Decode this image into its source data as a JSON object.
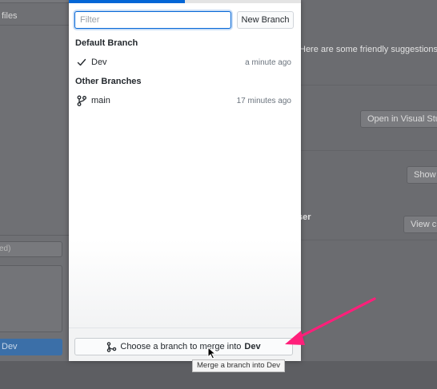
{
  "background": {
    "left_panel": {
      "files_label": "files",
      "summary_fragment": "ed)",
      "commit_fragment": "Dev"
    },
    "right_panel": {
      "suggestions_fragment": "Here are some friendly suggestions",
      "open_editor_fragment": "Open in Visual Stu",
      "show_fragment": "Show",
      "ser_fragment": "ser",
      "view_fragment": "View c"
    }
  },
  "popover": {
    "filter": {
      "placeholder": "Filter",
      "value": ""
    },
    "new_branch_label": "New Branch",
    "default_branch_header": "Default Branch",
    "default_branch": {
      "name": "Dev",
      "time": "a minute ago",
      "icon": "check-icon"
    },
    "other_branches_header": "Other Branches",
    "other_branches": [
      {
        "name": "main",
        "time": "17 minutes ago",
        "icon": "git-branch-icon"
      }
    ],
    "merge_button": {
      "prefix": "Choose a branch to merge into",
      "branch": "Dev",
      "icon": "git-merge-icon"
    },
    "tooltip": "Merge a branch into Dev"
  },
  "colors": {
    "accent": "#0366d6",
    "annotation_arrow": "#ff1f7a"
  }
}
